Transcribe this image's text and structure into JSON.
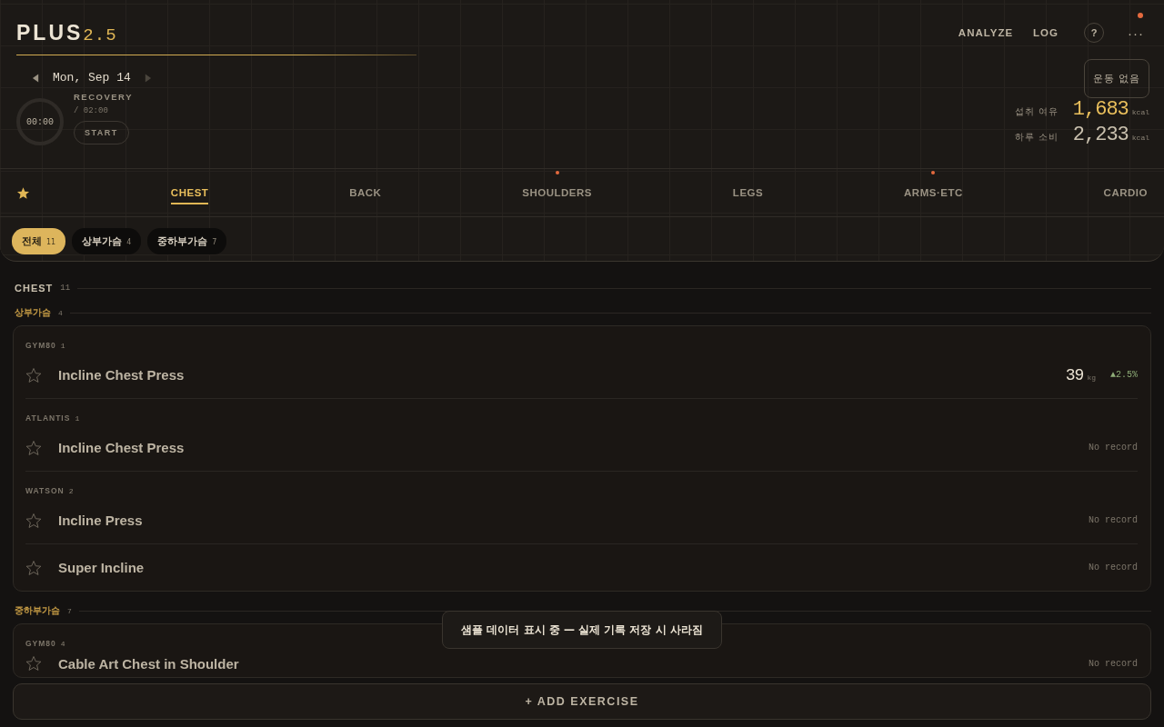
{
  "brand": {
    "name": "PLUS",
    "version": "2.5"
  },
  "nav": [
    {
      "label": "ANALYZE"
    },
    {
      "label": "LOG"
    }
  ],
  "help": "?",
  "more": {
    "label": "···",
    "alert": true
  },
  "date": "Mon, Sep 14",
  "timer": {
    "time": "00:00",
    "label": "RECOVERY",
    "total": "/ 02:00",
    "button": "START"
  },
  "workout_status": "운동 없음",
  "calories": [
    {
      "label": "섭취 여유",
      "value": "1,683",
      "unit": "kcal",
      "kind": "highlight"
    },
    {
      "label": "하루 소비",
      "value": "2,233",
      "unit": "kcal",
      "kind": "plain"
    }
  ],
  "tabs": [
    {
      "label": "CHEST",
      "selected": true,
      "alert": false
    },
    {
      "label": "BACK",
      "selected": false,
      "alert": false
    },
    {
      "label": "SHOULDERS",
      "selected": false,
      "alert": true
    },
    {
      "label": "LEGS",
      "selected": false,
      "alert": false
    },
    {
      "label": "ARMS·ETC",
      "selected": false,
      "alert": true
    },
    {
      "label": "CARDIO",
      "selected": false,
      "alert": false
    }
  ],
  "filters": [
    {
      "label": "전체",
      "count": "11",
      "selected": true
    },
    {
      "label": "상부가슴",
      "count": "4",
      "selected": false
    },
    {
      "label": "중하부가슴",
      "count": "7",
      "selected": false
    }
  ],
  "section": {
    "title": "CHEST",
    "count": "11"
  },
  "groups": [
    {
      "title": "상부가슴",
      "count": "4",
      "brands": [
        {
          "name": "GYM80",
          "count": "1",
          "exercises": [
            {
              "name": "Incline Chest Press",
              "favorite": false,
              "weight": "39",
              "unit": "kg",
              "change": "▲2.5%"
            }
          ]
        },
        {
          "name": "ATLANTIS",
          "count": "1",
          "exercises": [
            {
              "name": "Incline Chest Press",
              "favorite": false,
              "record": "No record"
            }
          ]
        },
        {
          "name": "WATSON",
          "count": "2",
          "exercises": [
            {
              "name": "Incline Press",
              "favorite": false,
              "record": "No record"
            },
            {
              "name": "Super Incline",
              "favorite": false,
              "record": "No record"
            }
          ]
        }
      ]
    },
    {
      "title": "중하부가슴",
      "count": "7",
      "brands": [
        {
          "name": "GYM80",
          "count": "4",
          "exercises": [
            {
              "name": "Cable Art Chest in Shoulder",
              "favorite": false,
              "record": "No record"
            }
          ]
        }
      ]
    }
  ],
  "toast": "샘플 데이터 표시 중 — 실제 기록 저장 시 사라짐",
  "add_button": "+ ADD EXERCISE"
}
